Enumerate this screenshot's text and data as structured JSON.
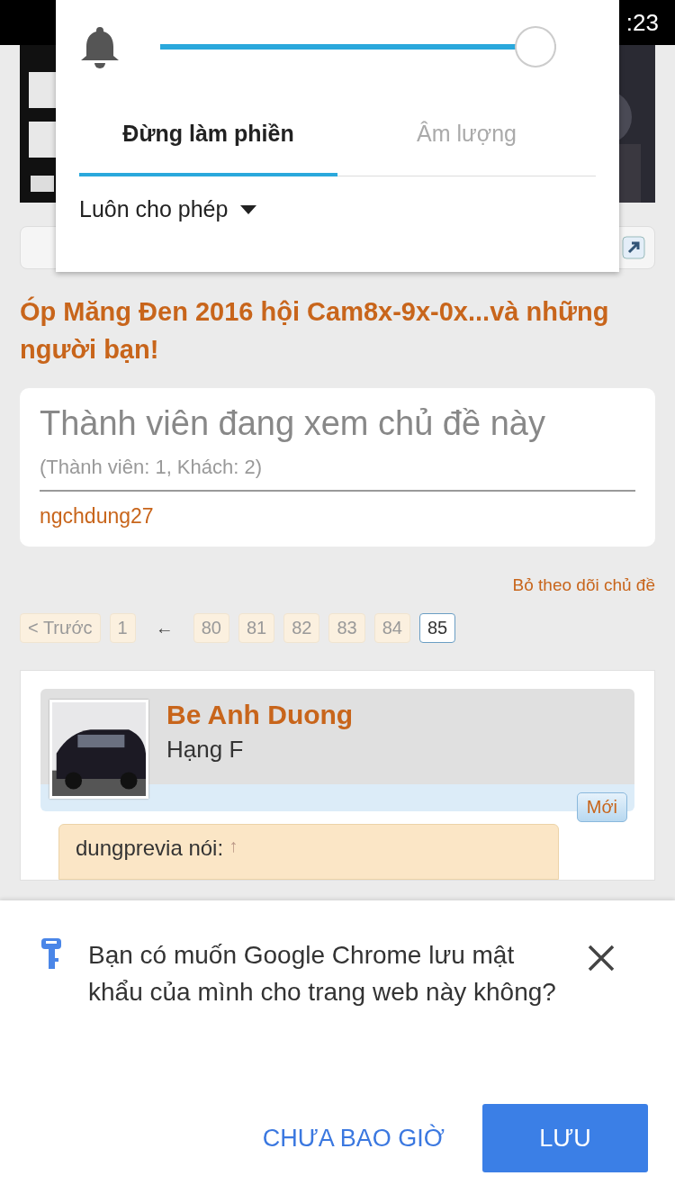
{
  "status_bar": {
    "time": ":23"
  },
  "volume_panel": {
    "level": 1,
    "tabs": [
      {
        "label": "Đừng làm phiền",
        "selected": true
      },
      {
        "label": "Âm lượng",
        "selected": false
      }
    ],
    "mode": "Luôn cho phép"
  },
  "thread": {
    "title": "Óp Măng Đen 2016 hội Cam8x-9x-0x...và những người bạn!",
    "viewers": {
      "heading": "Thành viên đang xem chủ đề này",
      "counts": "(Thành viên: 1, Khách: 2)",
      "members": [
        "ngchdung27"
      ]
    },
    "unwatch": "Bỏ theo dõi chủ đề",
    "pagination": [
      {
        "label": "< Trước",
        "kind": "page",
        "selected": false
      },
      {
        "label": "1",
        "kind": "page",
        "selected": false
      },
      {
        "label": "←",
        "kind": "gap"
      },
      {
        "label": "80",
        "kind": "page",
        "selected": false
      },
      {
        "label": "81",
        "kind": "page",
        "selected": false
      },
      {
        "label": "82",
        "kind": "page",
        "selected": false
      },
      {
        "label": "83",
        "kind": "page",
        "selected": false
      },
      {
        "label": "84",
        "kind": "page",
        "selected": false
      },
      {
        "label": "85",
        "kind": "page",
        "selected": true
      }
    ],
    "post": {
      "author": "Be Anh Duong",
      "rank": "Hạng F",
      "badge": "Mới",
      "quote_author": "dungprevia nói:",
      "quote_link": "↑"
    }
  },
  "save_password": {
    "message": "Bạn có muốn Google Chrome lưu mật khẩu của mình cho trang web này không?",
    "buttons": [
      {
        "label": "CHƯA BAO GIỜ",
        "kind": "text"
      },
      {
        "label": "LƯU",
        "kind": "primary"
      }
    ]
  }
}
